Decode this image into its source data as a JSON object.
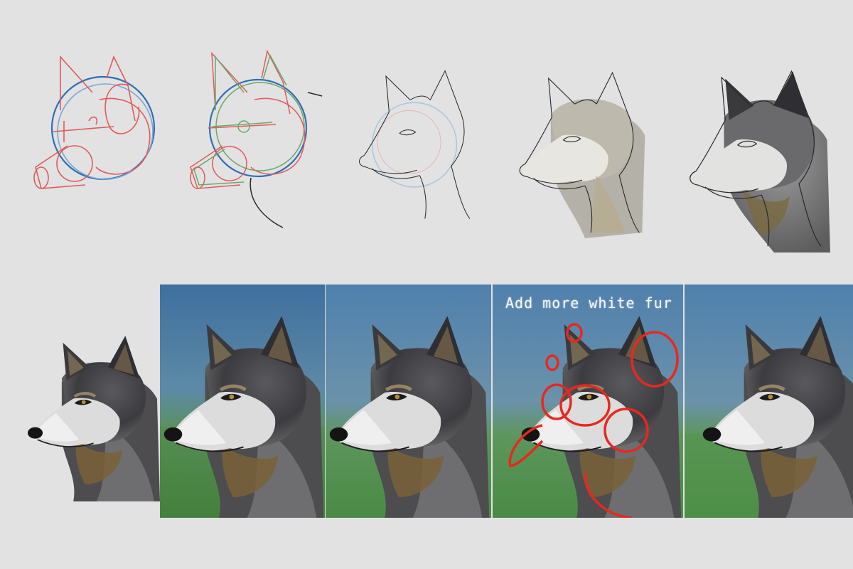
{
  "steps": [
    {
      "id": 1,
      "kind": "construction-shapes"
    },
    {
      "id": 2,
      "kind": "construction-refined"
    },
    {
      "id": 3,
      "kind": "line-sketch"
    },
    {
      "id": 4,
      "kind": "flat-color"
    },
    {
      "id": 5,
      "kind": "shaded-gray"
    },
    {
      "id": 6,
      "kind": "detailed-fur"
    },
    {
      "id": 7,
      "kind": "blue-green-background"
    },
    {
      "id": 8,
      "kind": "blue-green-background-refined"
    },
    {
      "id": 9,
      "kind": "critique-markup"
    },
    {
      "id": 10,
      "kind": "final-painting"
    }
  ],
  "critique_note": "Add more white fur",
  "colors": {
    "page_bg": "#e2e2e2",
    "sketch_red": "#e05a5a",
    "sketch_blue": "#2f6fb5",
    "sketch_green": "#6aa86a",
    "markup_red": "#e8281e",
    "sky_blue": "#4f82b0",
    "grass_green": "#4e8c4a",
    "fur_dark": "#3a3a3c",
    "fur_light": "#dadada",
    "fur_brown": "#7a6238"
  }
}
